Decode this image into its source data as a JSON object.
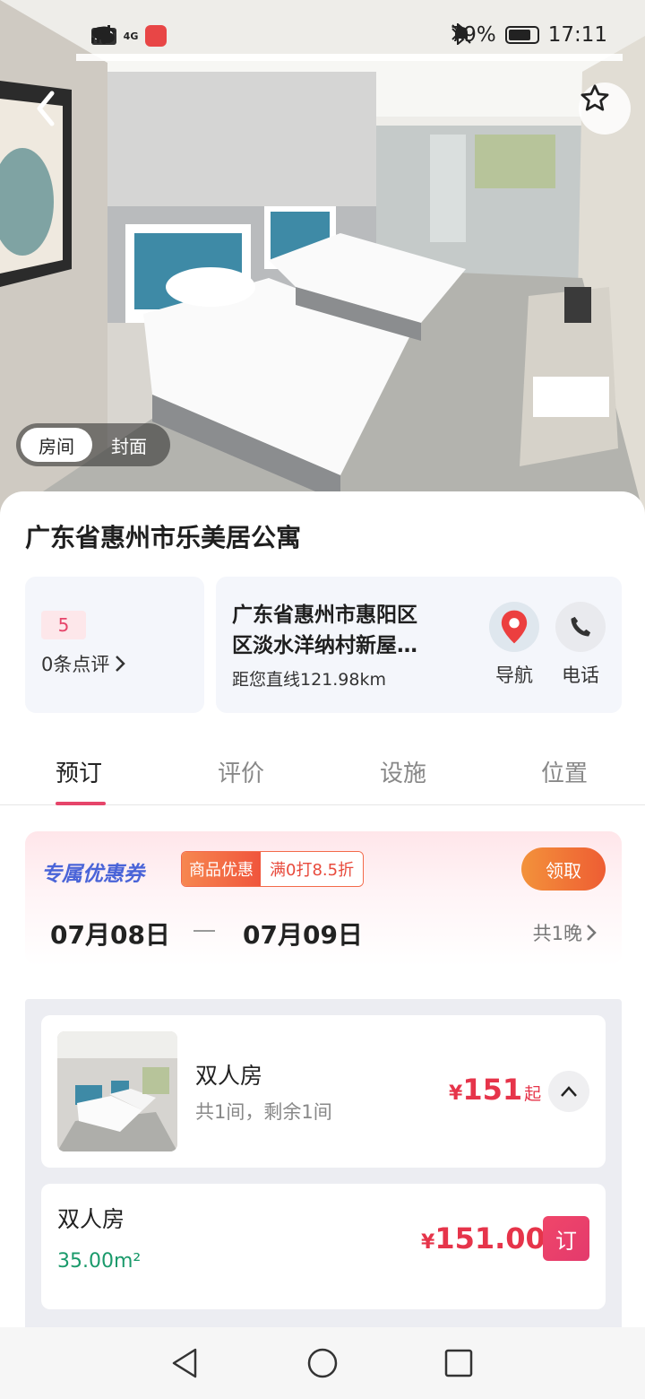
{
  "status_bar": {
    "left_badges": [
      "HD",
      "4G"
    ],
    "icons": [
      "signal-icon",
      "wifi-icon",
      "app-store-icon",
      "wechat-icon"
    ],
    "right_icons": [
      "bluetooth-icon",
      "mute-icon"
    ],
    "battery_text": "79%",
    "battery_level": 0.79,
    "time": "17:11"
  },
  "hero": {
    "toggle": {
      "active": "房间",
      "other": "封面"
    }
  },
  "hotel": {
    "name": "广东省惠州市乐美居公寓",
    "score": "5",
    "reviews_link": "0条点评",
    "address_line1": "广东省惠州市惠阳区",
    "address_line2": "区淡水洋纳村新屋…",
    "distance": "距您直线121.98km",
    "nav_label": "导航",
    "call_label": "电话"
  },
  "tabs": [
    {
      "label": "预订",
      "active": true
    },
    {
      "label": "评价",
      "active": false
    },
    {
      "label": "设施",
      "active": false
    },
    {
      "label": "位置",
      "active": false
    }
  ],
  "coupon": {
    "title": "专属优惠券",
    "tag_left": "商品优惠",
    "tag_right": "满0打8.5折",
    "claim_label": "领取",
    "check_in": "07月08日",
    "check_out": "07月09日",
    "nights": "共1晚"
  },
  "room": {
    "name": "双人房",
    "availability": "共1间，剩余1间",
    "price_currency": "¥",
    "price": "151",
    "price_suffix": "起"
  },
  "rate": {
    "name": "双人房",
    "area": "35.00m²",
    "price_currency": "¥",
    "price": "151.00",
    "book_label": "订"
  },
  "colors": {
    "accent": "#e6456a",
    "price": "#e6344a",
    "area_green": "#1a9a6b",
    "coupon_blue": "#4a64d8"
  }
}
